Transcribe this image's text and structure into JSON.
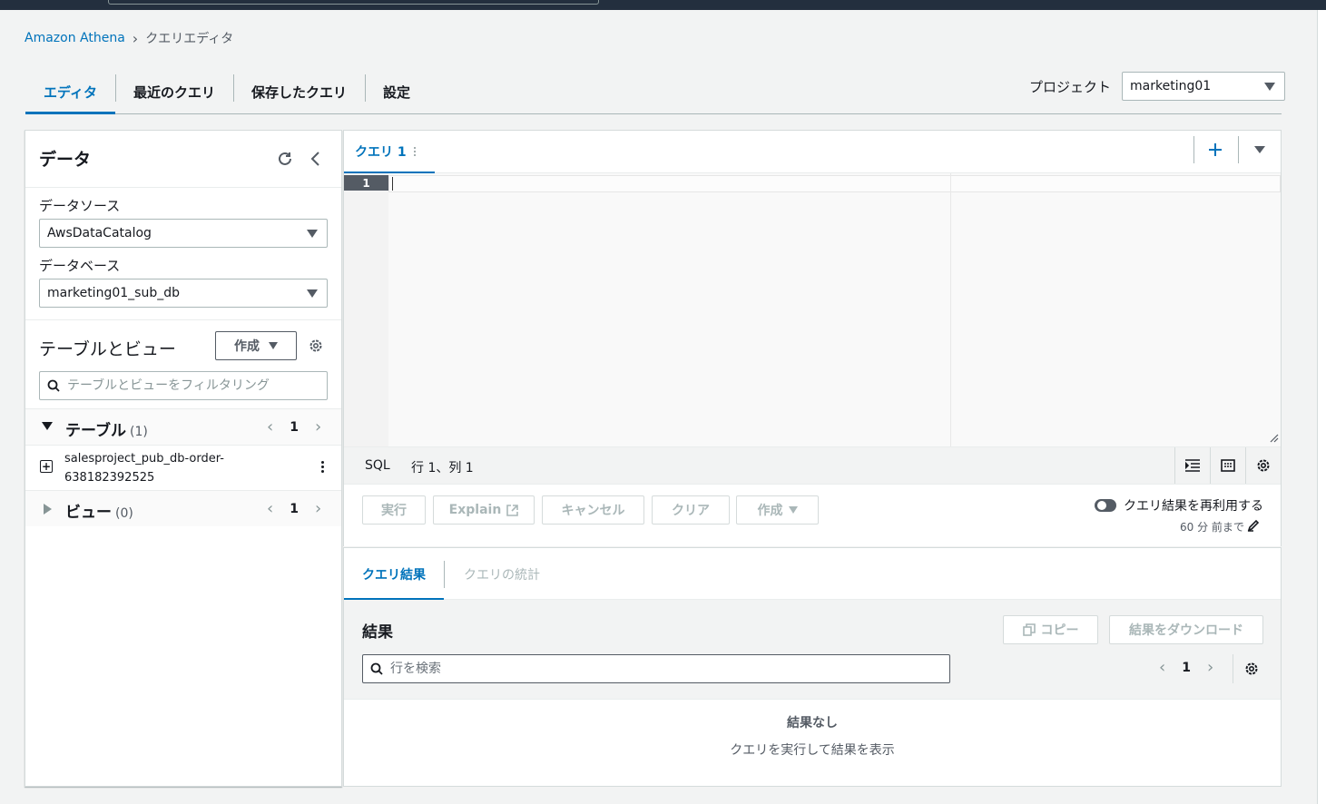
{
  "breadcrumb": {
    "root": "Amazon Athena",
    "current": "クエリエディタ"
  },
  "main_tabs": [
    {
      "label": "エディタ"
    },
    {
      "label": "最近のクエリ"
    },
    {
      "label": "保存したクエリ"
    },
    {
      "label": "設定"
    }
  ],
  "project": {
    "label": "プロジェクト",
    "value": "marketing01"
  },
  "data_panel": {
    "title": "データ",
    "data_source_label": "データソース",
    "data_source_value": "AwsDataCatalog",
    "database_label": "データベース",
    "database_value": "marketing01_sub_db",
    "tables_views_title": "テーブルとビュー",
    "create_button": "作成",
    "filter_placeholder": "テーブルとビューをフィルタリング",
    "tables": {
      "label": "テーブル",
      "count": "(1)",
      "page": "1",
      "items": [
        {
          "name": "salesproject_pub_db-order-638182392525"
        }
      ]
    },
    "views": {
      "label": "ビュー",
      "count": "(0)",
      "page": "1"
    }
  },
  "editor": {
    "tab_label": "クエリ 1",
    "line_number": "1",
    "status_language": "SQL",
    "status_position": "行 1、列 1",
    "buttons": {
      "run": "実行",
      "explain": "Explain",
      "cancel": "キャンセル",
      "clear": "クリア",
      "create": "作成"
    },
    "reuse_label": "クエリ結果を再利用する",
    "reuse_age": "60 分 前まで"
  },
  "results": {
    "tab_results": "クエリ結果",
    "tab_stats": "クエリの統計",
    "title": "結果",
    "copy_button": "コピー",
    "download_button": "結果をダウンロード",
    "search_placeholder": "行を検索",
    "page": "1",
    "empty_title": "結果なし",
    "empty_sub": "クエリを実行して結果を表示"
  },
  "colors": {
    "accent": "#0073bb",
    "topbar": "#232f3e",
    "page_bg": "#f2f3f3"
  },
  "icons": [
    "refresh-icon",
    "collapse-icon",
    "settings-icon",
    "search-icon",
    "plus-icon",
    "chevron-down-icon",
    "external-link-icon",
    "copy-icon",
    "edit-icon",
    "indent-icon",
    "keyboard-icon"
  ]
}
